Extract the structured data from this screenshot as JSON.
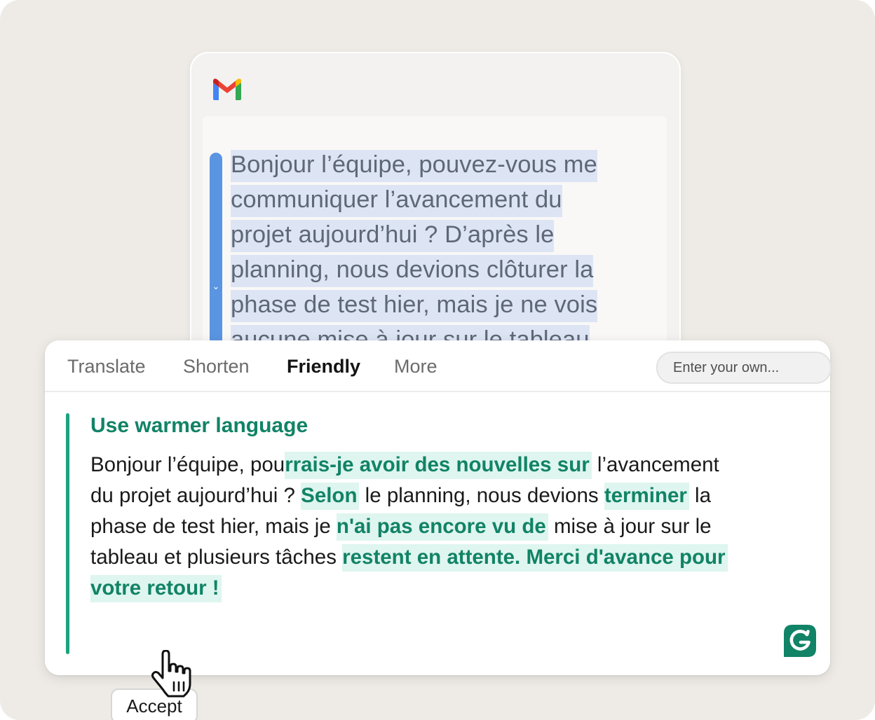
{
  "email": {
    "lines": [
      "Bonjour l’équipe, pouvez-vous me",
      "communiquer l’avancement du",
      "projet aujourd’hui ? D’après le",
      "planning, nous devions clôturer la",
      "phase de test hier, mais je ne vois",
      "aucune mise à jour sur le tableau"
    ]
  },
  "tabs": [
    {
      "label": "Translate"
    },
    {
      "label": "Shorten"
    },
    {
      "label": "Friendly"
    },
    {
      "label": "More"
    }
  ],
  "active_tab": "Friendly",
  "own_input": {
    "placeholder": "Enter your own...",
    "value": ""
  },
  "suggestion": {
    "title": "Use warmer language",
    "lines": [
      [
        {
          "text": "Bonjour l’équipe, pou",
          "highlight": false
        },
        {
          "text": "rrais-je avoir des nouvelles sur",
          "highlight": true
        },
        {
          "text": " l’avancement",
          "highlight": false
        }
      ],
      [
        {
          "text": "du projet aujourd’hui ? ",
          "highlight": false
        },
        {
          "text": "Selon",
          "highlight": true
        },
        {
          "text": " le planning, nous devions ",
          "highlight": false
        },
        {
          "text": "terminer",
          "highlight": true
        },
        {
          "text": " la",
          "highlight": false
        }
      ],
      [
        {
          "text": "phase de test hier, mais je ",
          "highlight": false
        },
        {
          "text": "n'ai pas encore vu de",
          "highlight": true
        },
        {
          "text": " mise à jour sur le",
          "highlight": false
        }
      ],
      [
        {
          "text": "tableau et plusieurs tâches ",
          "highlight": false
        },
        {
          "text": "restent en attente. Merci d'avance pour",
          "highlight": true
        }
      ],
      [
        {
          "text": "votre retour !",
          "highlight": true
        }
      ]
    ],
    "accept_label": "Accept"
  },
  "icons": {
    "mail_app": "gmail-icon",
    "assistant": "grammarly-icon",
    "pointer": "hand-cursor-icon",
    "selection_handle": "chevron-down-icon"
  },
  "colors": {
    "accent_green": "#118366",
    "highlight_bg": "#dff5ef",
    "selection_blue": "#5a95e1",
    "selection_bg": "#dde5f4"
  }
}
